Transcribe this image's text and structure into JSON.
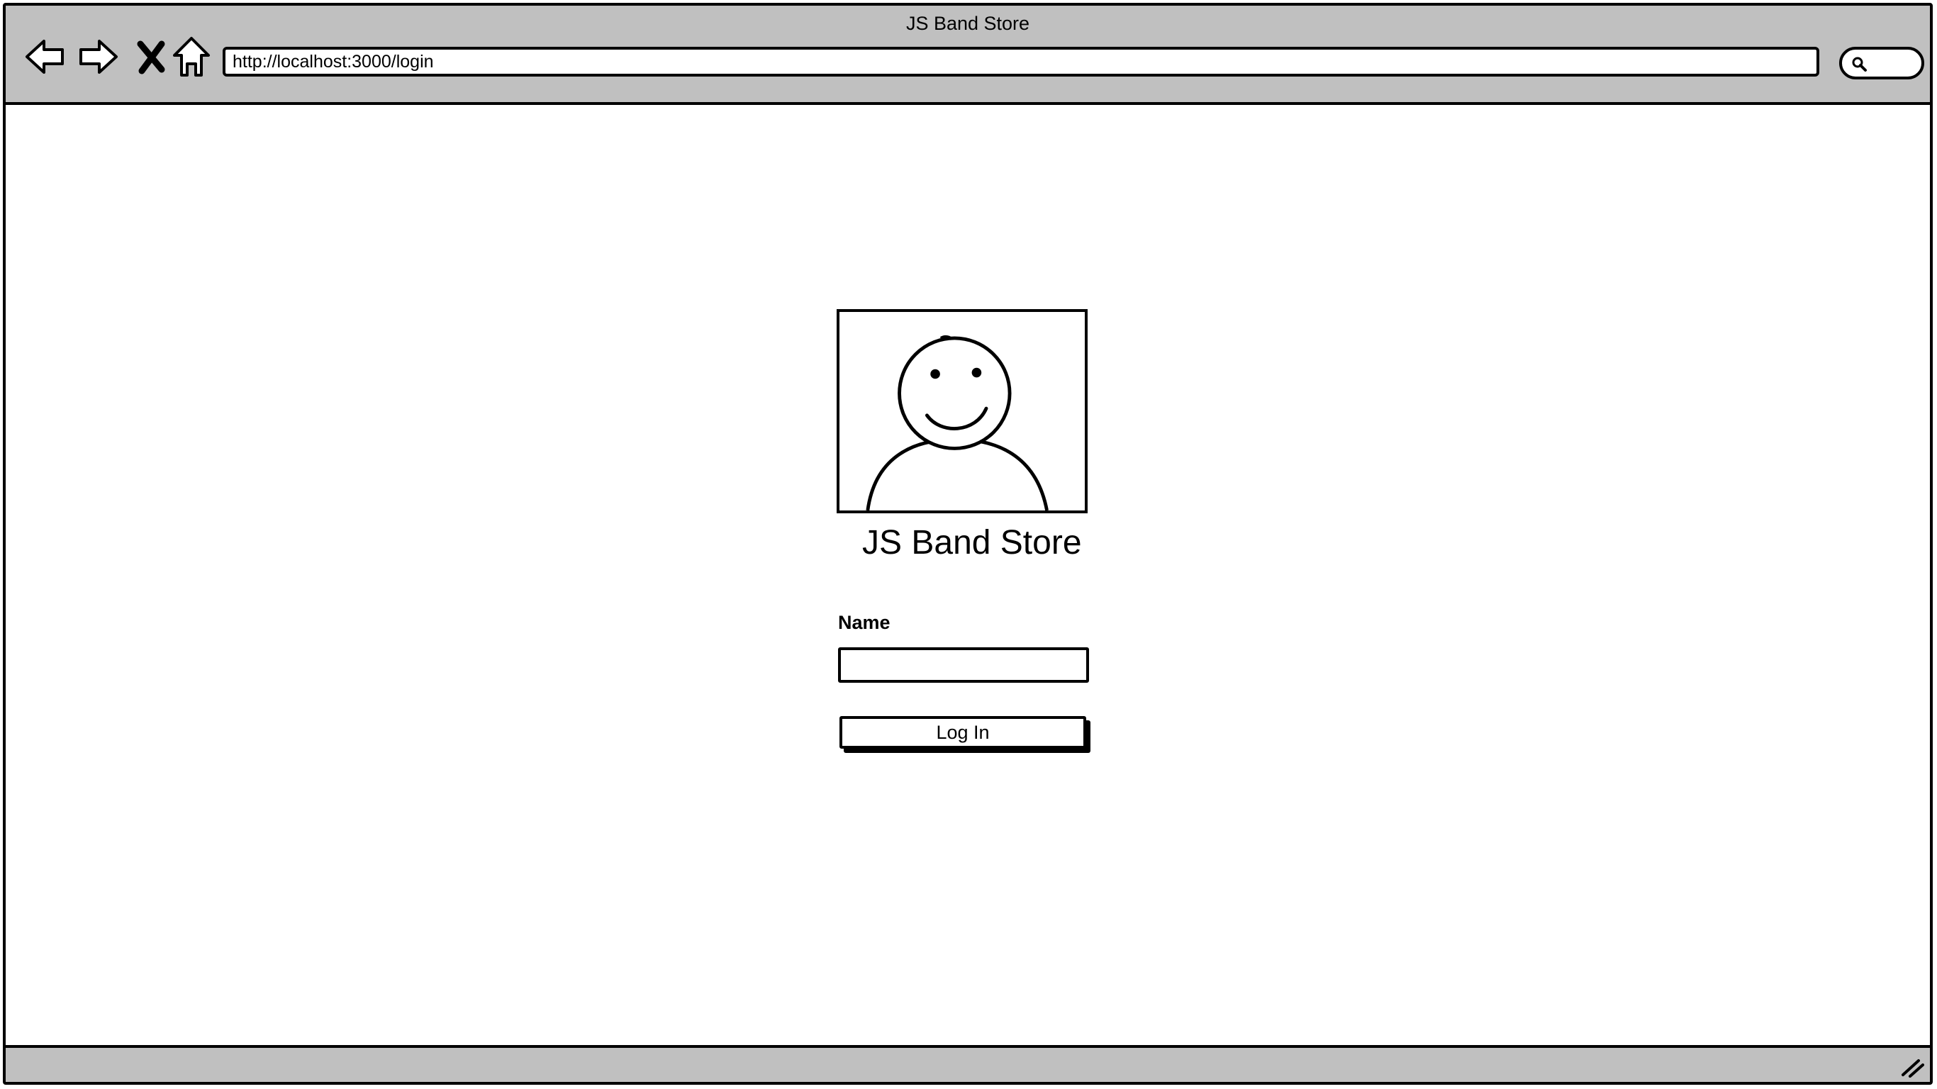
{
  "window": {
    "title": "JS Band Store"
  },
  "toolbar": {
    "back_icon": "back-arrow-icon",
    "forward_icon": "forward-arrow-icon",
    "stop_icon": "close-icon",
    "home_icon": "home-icon",
    "url": "http://localhost:3000/login",
    "search_icon": "search-icon"
  },
  "page": {
    "avatar_icon": "user-avatar-icon",
    "store_title": "JS Band Store",
    "name_label": "Name",
    "name_value": "",
    "login_button_label": "Log In"
  },
  "statusbar": {
    "resize_icon": "resize-grip-icon"
  },
  "colors": {
    "chrome": "#c0c0c0",
    "border": "#000000",
    "background": "#ffffff"
  }
}
